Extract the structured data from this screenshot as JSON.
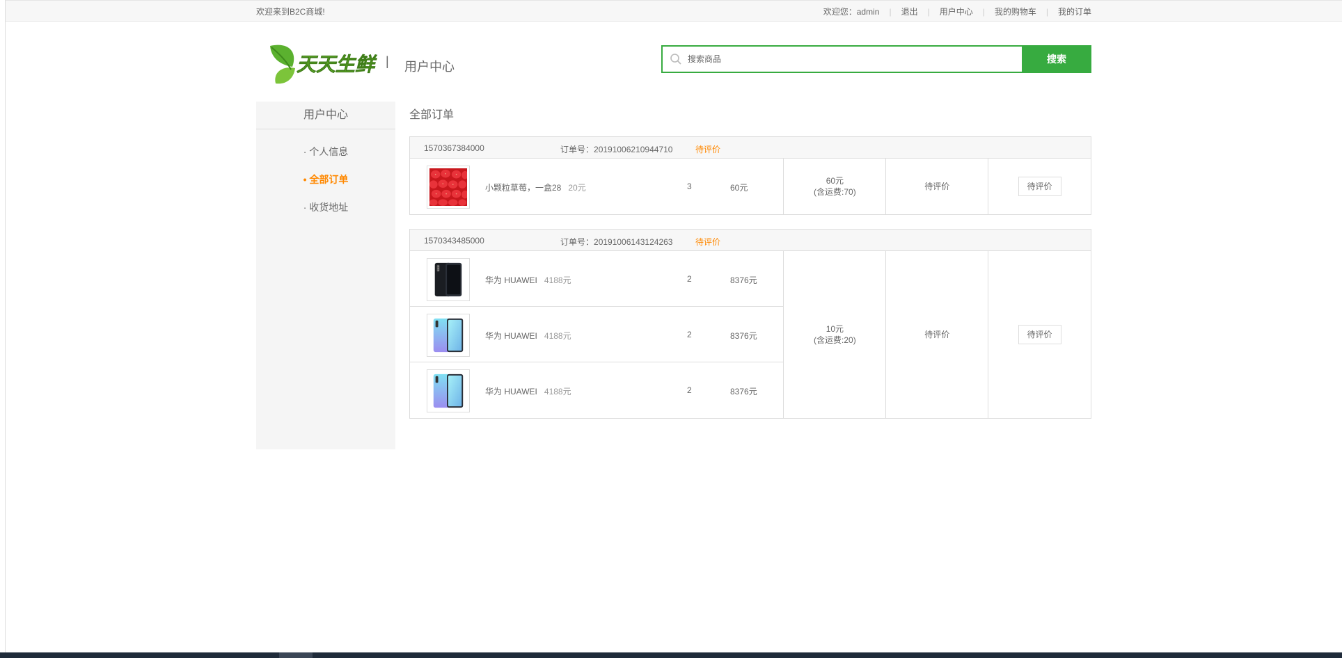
{
  "topbar": {
    "welcome": "欢迎来到B2C商城!",
    "greeting": "欢迎您：",
    "username": "admin",
    "logout": "退出",
    "user_center": "用户中心",
    "cart": "我的购物车",
    "orders": "我的订单"
  },
  "header": {
    "logo_text": "天天生鲜",
    "separator": "|",
    "title": "用户中心"
  },
  "search": {
    "placeholder": "搜索商品",
    "button": "搜索"
  },
  "sidebar": {
    "title": "用户中心",
    "items": [
      {
        "label": "· 个人信息",
        "active": false
      },
      {
        "label": "• 全部订单",
        "active": true
      },
      {
        "label": "· 收货地址",
        "active": false
      }
    ]
  },
  "main": {
    "title": "全部订单",
    "orders": [
      {
        "time": "1570367384000",
        "order_no_label": "订单号：",
        "order_no": "20191006210944710",
        "status": "待评价",
        "goods": [
          {
            "name": "小颗粒草莓，一盒28",
            "price": "20元",
            "count": "3",
            "subtotal": "60元",
            "image": "strawberry-image"
          }
        ],
        "total": "60元",
        "freight": "(含运费:70)",
        "status_text": "待评价",
        "operation": "待评价"
      },
      {
        "time": "1570343485000",
        "order_no_label": "订单号：",
        "order_no": "20191006143124263",
        "status": "待评价",
        "goods": [
          {
            "name": "华为 HUAWEI",
            "price": "4188元",
            "count": "2",
            "subtotal": "8376元",
            "image": "phone-black-image"
          },
          {
            "name": "华为 HUAWEI",
            "price": "4188元",
            "count": "2",
            "subtotal": "8376元",
            "image": "phone-blue-image"
          },
          {
            "name": "华为 HUAWEI",
            "price": "4188元",
            "count": "2",
            "subtotal": "8376元",
            "image": "phone-blue-image"
          }
        ],
        "total": "10元",
        "freight": "(含运费:20)",
        "status_text": "待评价",
        "operation": "待评价"
      }
    ]
  },
  "colors": {
    "brand_green": "#37ab40",
    "accent_orange": "#ff8800",
    "border": "#dddddd",
    "panel_bg": "#f5f5f5"
  }
}
